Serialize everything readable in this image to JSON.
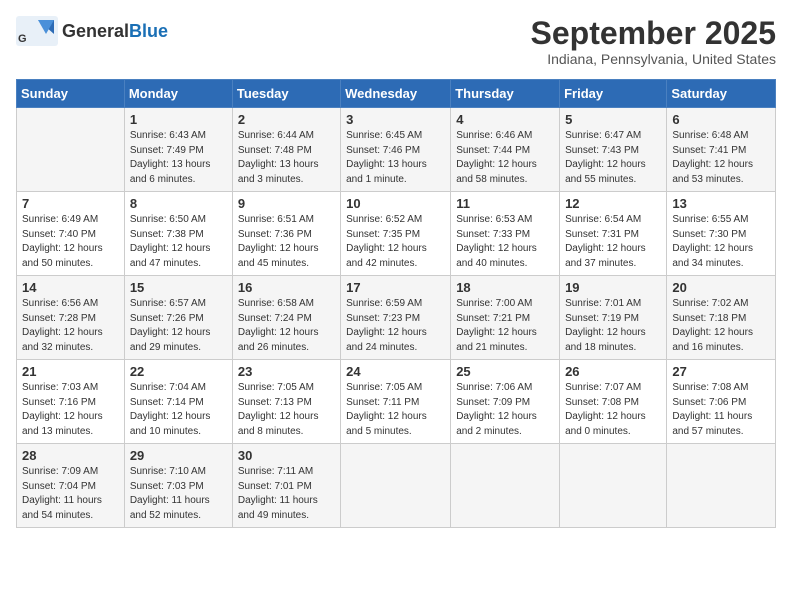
{
  "logo": {
    "general": "General",
    "blue": "Blue"
  },
  "header": {
    "month": "September 2025",
    "location": "Indiana, Pennsylvania, United States"
  },
  "days": [
    "Sunday",
    "Monday",
    "Tuesday",
    "Wednesday",
    "Thursday",
    "Friday",
    "Saturday"
  ],
  "weeks": [
    [
      {
        "day": "",
        "sunrise": "",
        "sunset": "",
        "daylight": ""
      },
      {
        "day": "1",
        "sunrise": "Sunrise: 6:43 AM",
        "sunset": "Sunset: 7:49 PM",
        "daylight": "Daylight: 13 hours and 6 minutes."
      },
      {
        "day": "2",
        "sunrise": "Sunrise: 6:44 AM",
        "sunset": "Sunset: 7:48 PM",
        "daylight": "Daylight: 13 hours and 3 minutes."
      },
      {
        "day": "3",
        "sunrise": "Sunrise: 6:45 AM",
        "sunset": "Sunset: 7:46 PM",
        "daylight": "Daylight: 13 hours and 1 minute."
      },
      {
        "day": "4",
        "sunrise": "Sunrise: 6:46 AM",
        "sunset": "Sunset: 7:44 PM",
        "daylight": "Daylight: 12 hours and 58 minutes."
      },
      {
        "day": "5",
        "sunrise": "Sunrise: 6:47 AM",
        "sunset": "Sunset: 7:43 PM",
        "daylight": "Daylight: 12 hours and 55 minutes."
      },
      {
        "day": "6",
        "sunrise": "Sunrise: 6:48 AM",
        "sunset": "Sunset: 7:41 PM",
        "daylight": "Daylight: 12 hours and 53 minutes."
      }
    ],
    [
      {
        "day": "7",
        "sunrise": "Sunrise: 6:49 AM",
        "sunset": "Sunset: 7:40 PM",
        "daylight": "Daylight: 12 hours and 50 minutes."
      },
      {
        "day": "8",
        "sunrise": "Sunrise: 6:50 AM",
        "sunset": "Sunset: 7:38 PM",
        "daylight": "Daylight: 12 hours and 47 minutes."
      },
      {
        "day": "9",
        "sunrise": "Sunrise: 6:51 AM",
        "sunset": "Sunset: 7:36 PM",
        "daylight": "Daylight: 12 hours and 45 minutes."
      },
      {
        "day": "10",
        "sunrise": "Sunrise: 6:52 AM",
        "sunset": "Sunset: 7:35 PM",
        "daylight": "Daylight: 12 hours and 42 minutes."
      },
      {
        "day": "11",
        "sunrise": "Sunrise: 6:53 AM",
        "sunset": "Sunset: 7:33 PM",
        "daylight": "Daylight: 12 hours and 40 minutes."
      },
      {
        "day": "12",
        "sunrise": "Sunrise: 6:54 AM",
        "sunset": "Sunset: 7:31 PM",
        "daylight": "Daylight: 12 hours and 37 minutes."
      },
      {
        "day": "13",
        "sunrise": "Sunrise: 6:55 AM",
        "sunset": "Sunset: 7:30 PM",
        "daylight": "Daylight: 12 hours and 34 minutes."
      }
    ],
    [
      {
        "day": "14",
        "sunrise": "Sunrise: 6:56 AM",
        "sunset": "Sunset: 7:28 PM",
        "daylight": "Daylight: 12 hours and 32 minutes."
      },
      {
        "day": "15",
        "sunrise": "Sunrise: 6:57 AM",
        "sunset": "Sunset: 7:26 PM",
        "daylight": "Daylight: 12 hours and 29 minutes."
      },
      {
        "day": "16",
        "sunrise": "Sunrise: 6:58 AM",
        "sunset": "Sunset: 7:24 PM",
        "daylight": "Daylight: 12 hours and 26 minutes."
      },
      {
        "day": "17",
        "sunrise": "Sunrise: 6:59 AM",
        "sunset": "Sunset: 7:23 PM",
        "daylight": "Daylight: 12 hours and 24 minutes."
      },
      {
        "day": "18",
        "sunrise": "Sunrise: 7:00 AM",
        "sunset": "Sunset: 7:21 PM",
        "daylight": "Daylight: 12 hours and 21 minutes."
      },
      {
        "day": "19",
        "sunrise": "Sunrise: 7:01 AM",
        "sunset": "Sunset: 7:19 PM",
        "daylight": "Daylight: 12 hours and 18 minutes."
      },
      {
        "day": "20",
        "sunrise": "Sunrise: 7:02 AM",
        "sunset": "Sunset: 7:18 PM",
        "daylight": "Daylight: 12 hours and 16 minutes."
      }
    ],
    [
      {
        "day": "21",
        "sunrise": "Sunrise: 7:03 AM",
        "sunset": "Sunset: 7:16 PM",
        "daylight": "Daylight: 12 hours and 13 minutes."
      },
      {
        "day": "22",
        "sunrise": "Sunrise: 7:04 AM",
        "sunset": "Sunset: 7:14 PM",
        "daylight": "Daylight: 12 hours and 10 minutes."
      },
      {
        "day": "23",
        "sunrise": "Sunrise: 7:05 AM",
        "sunset": "Sunset: 7:13 PM",
        "daylight": "Daylight: 12 hours and 8 minutes."
      },
      {
        "day": "24",
        "sunrise": "Sunrise: 7:05 AM",
        "sunset": "Sunset: 7:11 PM",
        "daylight": "Daylight: 12 hours and 5 minutes."
      },
      {
        "day": "25",
        "sunrise": "Sunrise: 7:06 AM",
        "sunset": "Sunset: 7:09 PM",
        "daylight": "Daylight: 12 hours and 2 minutes."
      },
      {
        "day": "26",
        "sunrise": "Sunrise: 7:07 AM",
        "sunset": "Sunset: 7:08 PM",
        "daylight": "Daylight: 12 hours and 0 minutes."
      },
      {
        "day": "27",
        "sunrise": "Sunrise: 7:08 AM",
        "sunset": "Sunset: 7:06 PM",
        "daylight": "Daylight: 11 hours and 57 minutes."
      }
    ],
    [
      {
        "day": "28",
        "sunrise": "Sunrise: 7:09 AM",
        "sunset": "Sunset: 7:04 PM",
        "daylight": "Daylight: 11 hours and 54 minutes."
      },
      {
        "day": "29",
        "sunrise": "Sunrise: 7:10 AM",
        "sunset": "Sunset: 7:03 PM",
        "daylight": "Daylight: 11 hours and 52 minutes."
      },
      {
        "day": "30",
        "sunrise": "Sunrise: 7:11 AM",
        "sunset": "Sunset: 7:01 PM",
        "daylight": "Daylight: 11 hours and 49 minutes."
      },
      {
        "day": "",
        "sunrise": "",
        "sunset": "",
        "daylight": ""
      },
      {
        "day": "",
        "sunrise": "",
        "sunset": "",
        "daylight": ""
      },
      {
        "day": "",
        "sunrise": "",
        "sunset": "",
        "daylight": ""
      },
      {
        "day": "",
        "sunrise": "",
        "sunset": "",
        "daylight": ""
      }
    ]
  ]
}
